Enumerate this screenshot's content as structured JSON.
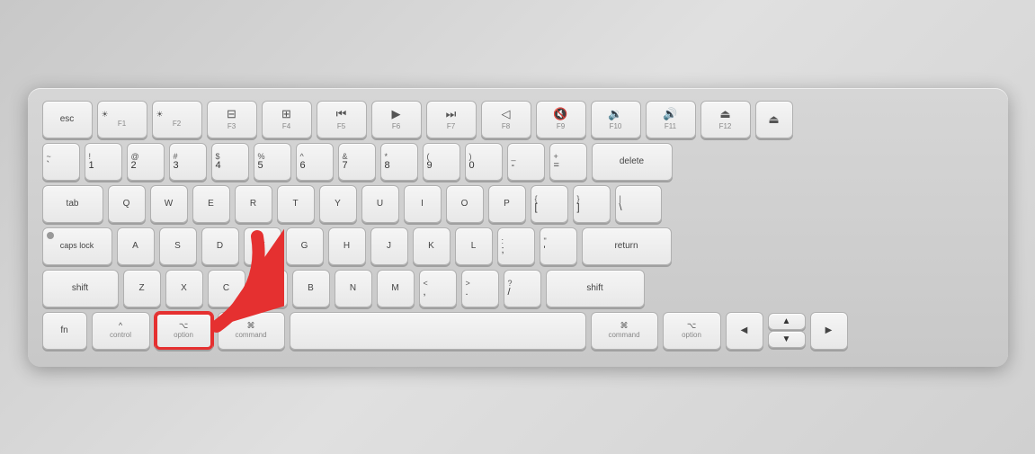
{
  "keyboard": {
    "rows": {
      "fn_row": {
        "keys": [
          {
            "id": "esc",
            "label": "esc",
            "width": "wesc"
          },
          {
            "id": "f1",
            "top": "☀",
            "bottom": "F1",
            "width": "wfkey"
          },
          {
            "id": "f2",
            "top": "☀",
            "bottom": "F2",
            "width": "wfkey"
          },
          {
            "id": "f3",
            "top": "⊞",
            "bottom": "F3",
            "width": "wfkey"
          },
          {
            "id": "f4",
            "top": "⊞⊞⊞",
            "bottom": "F4",
            "width": "wfkey"
          },
          {
            "id": "f5",
            "top": "⏮",
            "bottom": "F5",
            "width": "wfkey"
          },
          {
            "id": "f6",
            "top": "▶",
            "bottom": "F6",
            "width": "wfkey"
          },
          {
            "id": "f7",
            "top": "⏭",
            "bottom": "F7",
            "width": "wfkey"
          },
          {
            "id": "f8",
            "top": "◁",
            "bottom": "F8",
            "width": "wfkey"
          },
          {
            "id": "f9",
            "top": "🔇",
            "bottom": "F9",
            "width": "wfkey"
          },
          {
            "id": "f10",
            "top": "🔉",
            "bottom": "F10",
            "width": "wfkey"
          },
          {
            "id": "f11",
            "top": "🔊",
            "bottom": "F11",
            "width": "wfkey"
          },
          {
            "id": "f12",
            "top": "⏏",
            "bottom": "F12",
            "width": "wfkey"
          },
          {
            "id": "eject",
            "icon": "⏏",
            "width": "weject"
          }
        ]
      },
      "number_row": {
        "keys": [
          {
            "id": "tilde",
            "top": "~",
            "bottom": "`",
            "width": "w1"
          },
          {
            "id": "1",
            "top": "!",
            "bottom": "1",
            "width": "w1"
          },
          {
            "id": "2",
            "top": "@",
            "bottom": "2",
            "width": "w1"
          },
          {
            "id": "3",
            "top": "#",
            "bottom": "3",
            "width": "w1"
          },
          {
            "id": "4",
            "top": "$",
            "bottom": "4",
            "width": "w1"
          },
          {
            "id": "5",
            "top": "%",
            "bottom": "5",
            "width": "w1"
          },
          {
            "id": "6",
            "top": "^",
            "bottom": "6",
            "width": "w1"
          },
          {
            "id": "7",
            "top": "&",
            "bottom": "7",
            "width": "w1"
          },
          {
            "id": "8",
            "top": "*",
            "bottom": "8",
            "width": "w1"
          },
          {
            "id": "9",
            "top": "(",
            "bottom": "9",
            "width": "w1"
          },
          {
            "id": "0",
            "top": ")",
            "bottom": "0",
            "width": "w1"
          },
          {
            "id": "minus",
            "top": "_",
            "bottom": "-",
            "width": "w1"
          },
          {
            "id": "equals",
            "top": "+",
            "bottom": "=",
            "width": "w1"
          },
          {
            "id": "delete",
            "label": "delete",
            "width": "wdel"
          }
        ]
      },
      "tab_row": {
        "keys": [
          {
            "id": "tab",
            "label": "tab",
            "width": "wtab"
          },
          {
            "id": "q",
            "label": "Q",
            "width": "w1"
          },
          {
            "id": "w",
            "label": "W",
            "width": "w1"
          },
          {
            "id": "e",
            "label": "E",
            "width": "w1"
          },
          {
            "id": "r",
            "label": "R",
            "width": "w1"
          },
          {
            "id": "t",
            "label": "T",
            "width": "w1"
          },
          {
            "id": "y",
            "label": "Y",
            "width": "w1"
          },
          {
            "id": "u",
            "label": "U",
            "width": "w1"
          },
          {
            "id": "i",
            "label": "I",
            "width": "w1"
          },
          {
            "id": "o",
            "label": "O",
            "width": "w1"
          },
          {
            "id": "p",
            "label": "P",
            "width": "w1"
          },
          {
            "id": "lbracket",
            "top": "{",
            "bottom": "[",
            "width": "w1"
          },
          {
            "id": "rbracket",
            "top": "}",
            "bottom": "]",
            "width": "w1"
          },
          {
            "id": "backslash",
            "top": "|",
            "bottom": "\\",
            "width": "w1h"
          }
        ]
      },
      "caps_row": {
        "keys": [
          {
            "id": "capslock",
            "label": "caps lock",
            "width": "wcapslock",
            "dot": true
          },
          {
            "id": "a",
            "label": "A",
            "width": "w1"
          },
          {
            "id": "s",
            "label": "S",
            "width": "w1"
          },
          {
            "id": "d",
            "label": "D",
            "width": "w1"
          },
          {
            "id": "f",
            "label": "F",
            "width": "w1"
          },
          {
            "id": "g",
            "label": "G",
            "width": "w1"
          },
          {
            "id": "h",
            "label": "H",
            "width": "w1"
          },
          {
            "id": "j",
            "label": "J",
            "width": "w1"
          },
          {
            "id": "k",
            "label": "K",
            "width": "w1"
          },
          {
            "id": "l",
            "label": "L",
            "width": "w1"
          },
          {
            "id": "semicolon",
            "top": ":",
            "bottom": ";",
            "width": "w1"
          },
          {
            "id": "quote",
            "top": "\"",
            "bottom": "'",
            "width": "w1"
          },
          {
            "id": "return",
            "label": "return",
            "width": "wreturn"
          }
        ]
      },
      "shift_row": {
        "keys": [
          {
            "id": "shift-l",
            "label": "shift",
            "width": "wshift-l"
          },
          {
            "id": "z",
            "label": "Z",
            "width": "w1"
          },
          {
            "id": "x",
            "label": "X",
            "width": "w1"
          },
          {
            "id": "c",
            "label": "C",
            "width": "w1"
          },
          {
            "id": "v",
            "label": "V",
            "width": "w1"
          },
          {
            "id": "b",
            "label": "B",
            "width": "w1"
          },
          {
            "id": "n",
            "label": "N",
            "width": "w1"
          },
          {
            "id": "m",
            "label": "M",
            "width": "w1"
          },
          {
            "id": "comma",
            "top": "<",
            "bottom": ",",
            "width": "w1"
          },
          {
            "id": "period",
            "top": ">",
            "bottom": ".",
            "width": "w1"
          },
          {
            "id": "slash",
            "top": "?",
            "bottom": "/",
            "width": "w1"
          },
          {
            "id": "shift-r",
            "label": "shift",
            "width": "wshift-r"
          }
        ]
      },
      "bottom_row": {
        "keys": [
          {
            "id": "fn",
            "label": "fn",
            "width": "wfn"
          },
          {
            "id": "control",
            "top": "^",
            "bottom": "control",
            "width": "wctrl"
          },
          {
            "id": "option-l",
            "top": "⌥",
            "bottom": "option",
            "width": "woption",
            "highlighted": true
          },
          {
            "id": "command-l",
            "top": "⌘",
            "bottom": "command",
            "width": "wcmd"
          },
          {
            "id": "space",
            "label": "",
            "width": "wspace"
          },
          {
            "id": "command-r",
            "top": "⌘",
            "bottom": "command",
            "width": "wcmd"
          },
          {
            "id": "option-r",
            "top": "⌥",
            "bottom": "option",
            "width": "woption"
          },
          {
            "id": "arrow-left",
            "label": "◀",
            "width": "warrow"
          },
          {
            "id": "arrow-up-down",
            "width": "warrow",
            "isUpDown": true
          },
          {
            "id": "arrow-right",
            "label": "▶",
            "width": "warrow"
          }
        ]
      }
    }
  }
}
